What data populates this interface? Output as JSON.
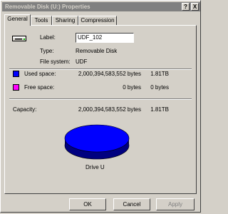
{
  "window": {
    "title": "Removable Disk (U:) Properties",
    "help_label": "?",
    "close_label": "X"
  },
  "tabs": [
    {
      "label": "General",
      "active": true
    },
    {
      "label": "Tools",
      "active": false
    },
    {
      "label": "Sharing",
      "active": false
    },
    {
      "label": "Compression",
      "active": false
    }
  ],
  "general": {
    "label_caption": "Label:",
    "label_value": "UDF_102",
    "type_caption": "Type:",
    "type_value": "Removable Disk",
    "fs_caption": "File system:",
    "fs_value": "UDF",
    "used": {
      "caption": "Used space:",
      "bytes": "2,000,394,583,552 bytes",
      "size": "1.81TB",
      "color": "#0000ff"
    },
    "free": {
      "caption": "Free space:",
      "bytes": "0 bytes",
      "size": "0 bytes",
      "color": "#ff00ff"
    },
    "capacity": {
      "caption": "Capacity:",
      "bytes": "2,000,394,583,552 bytes",
      "size": "1.81TB"
    },
    "drive_label": "Drive U"
  },
  "buttons": {
    "ok": "OK",
    "cancel": "Cancel",
    "apply": "Apply"
  },
  "colors": {
    "used": "#0000ff",
    "free": "#ff00ff",
    "titlebar": "#808080"
  },
  "icons": {
    "drive": "removable-drive-icon"
  }
}
